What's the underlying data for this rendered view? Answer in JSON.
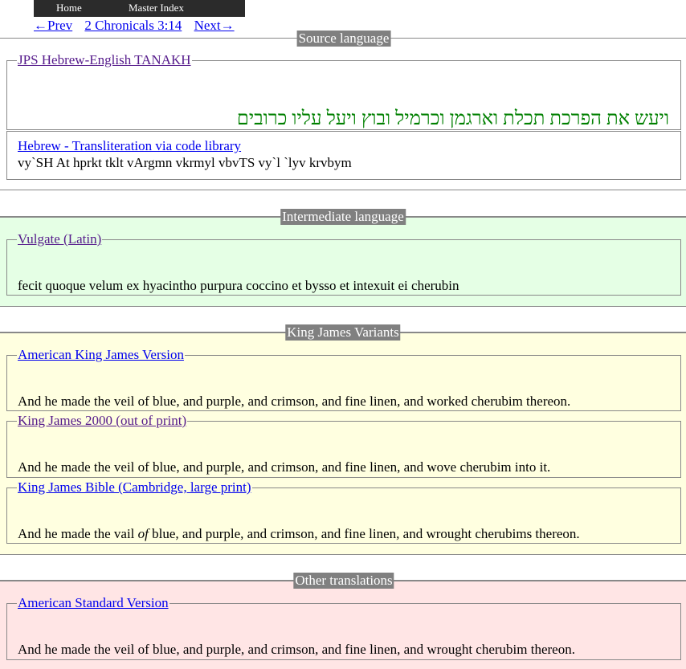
{
  "nav": {
    "home": "Home",
    "master_index": "Master Index",
    "prev": "←Prev",
    "reference": "2 Chronicals 3:14",
    "next": "Next→"
  },
  "sections": {
    "source": {
      "title": "Source language",
      "jps": {
        "legend": "JPS Hebrew-English TANAKH",
        "text": "ויעש את הפרכת תכלת וארגמן וכרמיל ובוץ ויעל עליו כרובים"
      },
      "translit": {
        "label": "Hebrew - Transliteration via code library",
        "text": "vy`SH At hprkt tklt vArgmn vkrmyl vbvTS vy`l `lyv krvbym"
      }
    },
    "intermediate": {
      "title": "Intermediate language",
      "vulgate": {
        "legend": "Vulgate (Latin)",
        "text": "fecit quoque velum ex hyacintho purpura coccino et bysso et intexuit ei cherubin"
      }
    },
    "kjv": {
      "title": "King James Variants",
      "akjv": {
        "legend": "American King James Version",
        "text": "And he made the veil of blue, and purple, and crimson, and fine linen, and worked cherubim thereon."
      },
      "kj2000": {
        "legend": "King James 2000 (out of print)",
        "text": "And he made the veil of blue, and purple, and crimson, and fine linen, and wove cherubim into it."
      },
      "kjb": {
        "legend": "King James Bible (Cambridge, large print)",
        "text_before": "And he made the vail ",
        "text_italic": "of",
        "text_after": " blue, and purple, and crimson, and fine linen, and wrought cherubims thereon."
      }
    },
    "other": {
      "title": "Other translations",
      "asv": {
        "legend": "American Standard Version",
        "text": "And he made the veil of blue, and purple, and crimson, and fine linen, and wrought cherubim thereon."
      }
    }
  },
  "colors": {
    "intermediate_bg": "#e5ffe5",
    "kjv_bg": "#ffffe0",
    "other_bg": "#ffe5e5",
    "hebrew_text": "#008000",
    "section_title_bg": "#808080",
    "nav_bg": "#2b2b2b"
  }
}
